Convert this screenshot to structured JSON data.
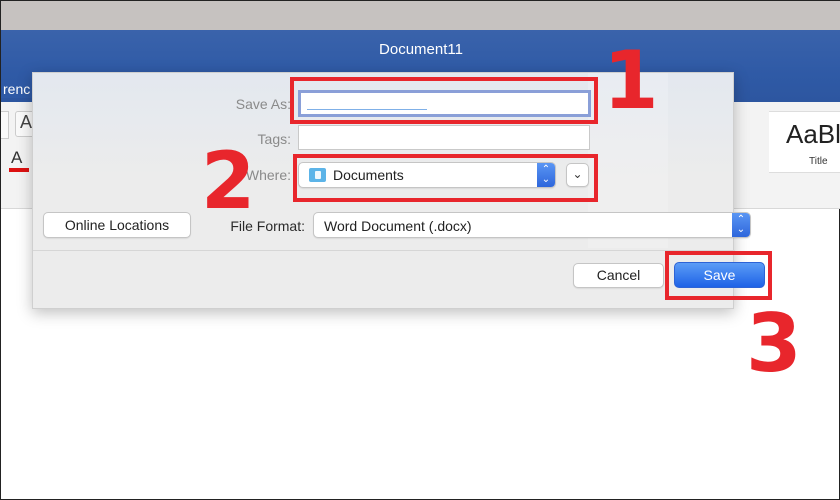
{
  "window": {
    "title": "Document11",
    "ribbon_tab_fragment": "renc",
    "ribbon_buttons": {
      "text_effects": "A",
      "font_color": "A"
    },
    "styles": {
      "preview": "AaBl",
      "label": "Title"
    }
  },
  "dialog": {
    "save_as": {
      "label": "Save As:",
      "value": ""
    },
    "tags": {
      "label": "Tags:",
      "value": ""
    },
    "where": {
      "label": "Where:",
      "value": "Documents",
      "icon": "folder-icon"
    },
    "online_locations_label": "Online Locations",
    "file_format": {
      "label": "File Format:",
      "value": "Word Document (.docx)"
    },
    "cancel_label": "Cancel",
    "save_label": "Save"
  },
  "annotations": {
    "step1": "1",
    "step2": "2",
    "step3": "3",
    "color": "#e8262c"
  }
}
